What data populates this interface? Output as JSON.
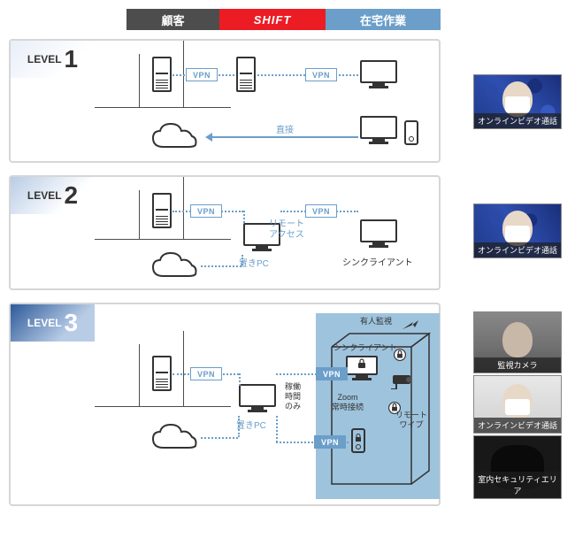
{
  "headers": {
    "customer": "顧客",
    "shift": "SHIFT",
    "home": "在宅作業"
  },
  "levels": {
    "l1": {
      "prefix": "LEVEL",
      "num": "1"
    },
    "l2": {
      "prefix": "LEVEL",
      "num": "2"
    },
    "l3": {
      "prefix": "LEVEL",
      "num": "3"
    }
  },
  "labels": {
    "vpn": "VPN",
    "direct": "直接",
    "remote_access": "リモート\nアクセス",
    "oki_pc": "置きPC",
    "thin_client": "シンクライアント",
    "manned": "有人監視",
    "working_hours": "稼働\n時間\nのみ",
    "zoom": "Zoom\n常時接続",
    "remote_wipe": "リモート\nワイプ"
  },
  "thumbs": {
    "online_video": "オンラインビデオ通話",
    "surv_cam": "監視カメラ",
    "sec_area": "室内セキュリティエリア"
  },
  "colors": {
    "accent": "#6b9ec9",
    "red": "#ec1c24",
    "dark": "#4d4d4d"
  }
}
